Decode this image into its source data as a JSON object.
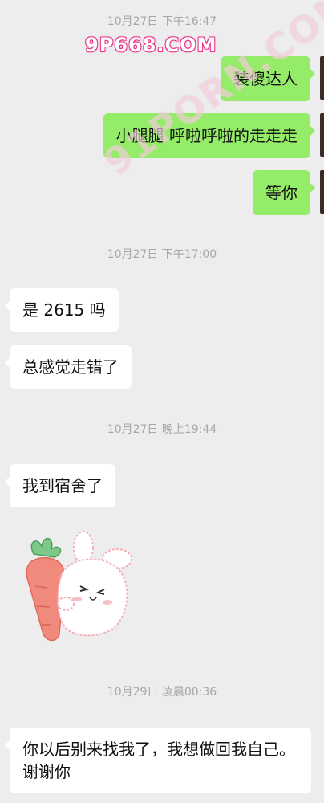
{
  "watermarks": {
    "small": "9P668.COM",
    "large": "91PORN.COM"
  },
  "messages": [
    {
      "type": "time",
      "text": "10月27日 下午16:47"
    },
    {
      "type": "out",
      "text": "装傻达人"
    },
    {
      "type": "out",
      "text": "小腿腿 呼啦呼啦的走走走"
    },
    {
      "type": "out",
      "text": "等你"
    },
    {
      "type": "time",
      "text": "10月27日 下午17:00"
    },
    {
      "type": "in",
      "text": "是 2615 吗"
    },
    {
      "type": "in",
      "text": "总感觉走错了"
    },
    {
      "type": "time",
      "text": "10月27日 晚上19:44"
    },
    {
      "type": "in",
      "text": "我到宿舍了"
    },
    {
      "type": "sticker",
      "icon": "bunny-carrot-sticker"
    },
    {
      "type": "time",
      "text": "10月29日 凌晨00:36"
    },
    {
      "type": "in",
      "text": "你以后别来找我了，我想做回我自己。谢谢你"
    }
  ],
  "colors": {
    "background": "#ededed",
    "outgoing": "#95ec69",
    "incoming": "#ffffff",
    "timestamp": "#a7a7a7"
  }
}
